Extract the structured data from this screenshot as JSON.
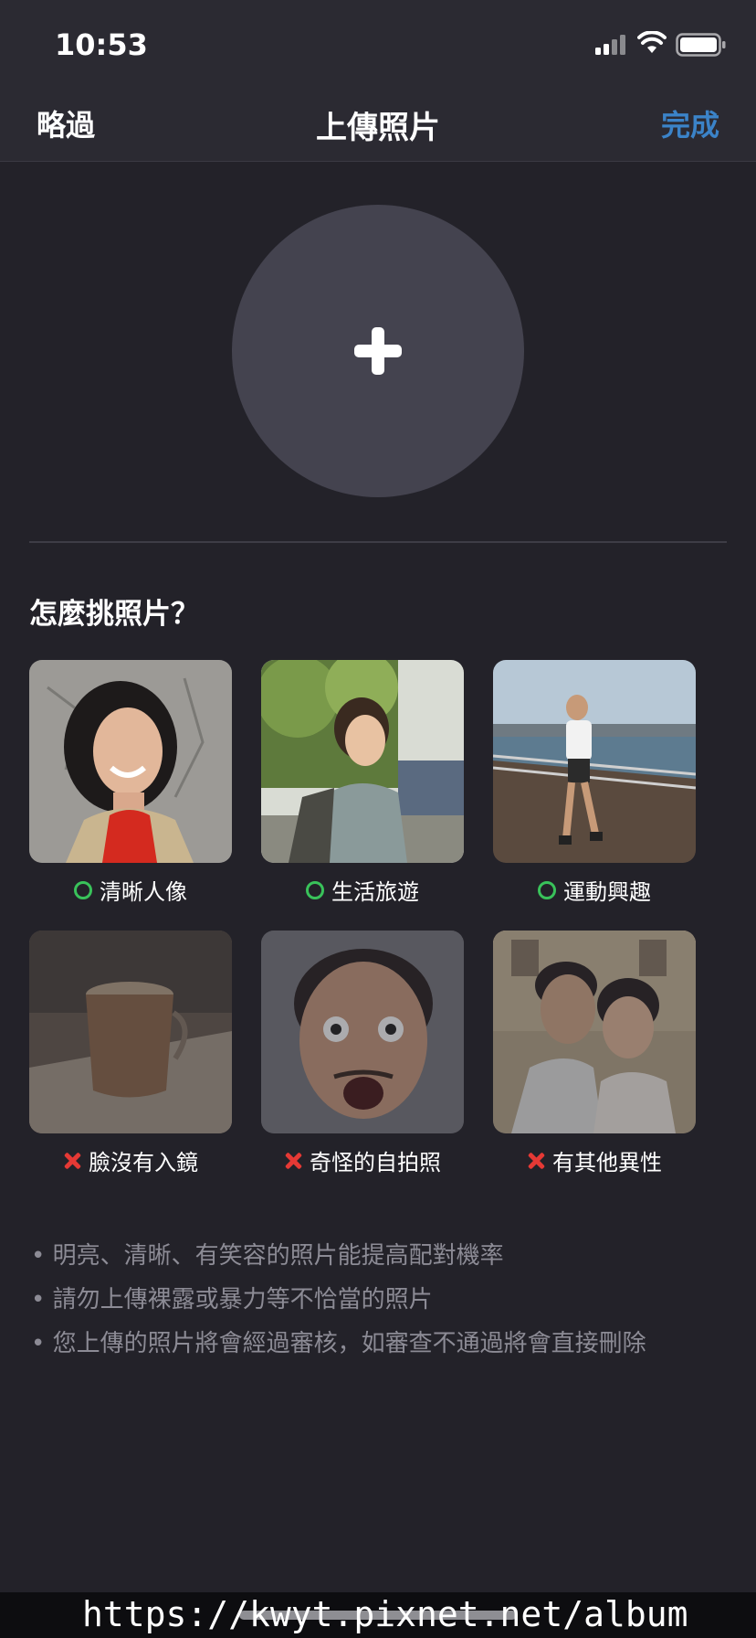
{
  "status": {
    "time": "10:53"
  },
  "nav": {
    "skip_label": "略過",
    "title": "上傳照片",
    "done_label": "完成",
    "done_color": "#3b83c8"
  },
  "upload": {
    "icon": "plus-icon"
  },
  "guide": {
    "title": "怎麼挑照片？",
    "good": [
      {
        "label": "清晰人像",
        "status_icon": "check-circle-icon"
      },
      {
        "label": "生活旅遊",
        "status_icon": "check-circle-icon"
      },
      {
        "label": "運動興趣",
        "status_icon": "check-circle-icon"
      }
    ],
    "bad": [
      {
        "label": "臉沒有入鏡",
        "status_icon": "cross-icon"
      },
      {
        "label": "奇怪的自拍照",
        "status_icon": "cross-icon"
      },
      {
        "label": "有其他異性",
        "status_icon": "cross-icon"
      }
    ]
  },
  "tips": [
    "明亮、清晰、有笑容的照片能提高配對機率",
    "請勿上傳裸露或暴力等不恰當的照片",
    "您上傳的照片將會經過審核，如審查不通過將會直接刪除"
  ],
  "watermark": "https://kwyt.pixnet.net/album",
  "colors": {
    "background": "#232229",
    "accent": "#3b83c8",
    "good": "#39c25a",
    "bad": "#e53935"
  }
}
